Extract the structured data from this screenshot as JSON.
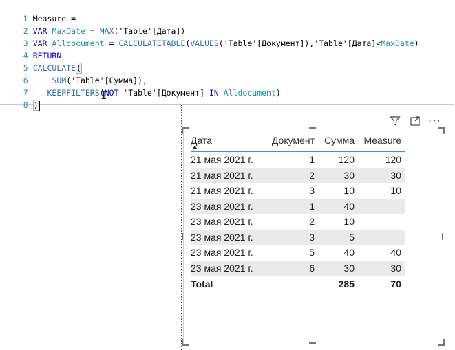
{
  "editor": {
    "lines": [
      {
        "num": "1"
      },
      {
        "num": "2"
      },
      {
        "num": "3"
      },
      {
        "num": "4"
      },
      {
        "num": "5"
      },
      {
        "num": "6"
      },
      {
        "num": "7"
      },
      {
        "num": "8"
      }
    ],
    "tokens": {
      "l1": "Measure =",
      "l2_var": "VAR",
      "l2_name": "MaxDate",
      "l2_eq": " = ",
      "l2_fn": "MAX",
      "l2_arg": "('Table'[Дата])",
      "l3_var": "VAR",
      "l3_name": "Alldocument",
      "l3_eq": " = ",
      "l3_fn1": "CALCULATETABLE",
      "l3_p1": "(",
      "l3_fn2": "VALUES",
      "l3_arg": "('Table'[Документ]),'Table'[Дата]<",
      "l3_var2": "MaxDate",
      "l3_close": ")",
      "l4": "RETURN",
      "l5_fn": "CALCULATE",
      "l5_p": "(",
      "l6_fn": "SUM",
      "l6_arg": "('Table'[Сумма]),",
      "l7_fn": "KEEPFILTERS",
      "l7_p": "(",
      "l7_not": "NOT",
      "l7_arg": " 'Table'[Документ] ",
      "l7_in": "IN",
      "l7_sp": " ",
      "l7_var": "Alldocument",
      "l7_close": ")",
      "l8": ")"
    }
  },
  "visual_header": {
    "filter_icon": "filter-icon",
    "focus_icon": "focus-mode-icon",
    "more_icon": "more-options-icon",
    "more_glyph": "···"
  },
  "matrix": {
    "columns": [
      "Дата",
      "Документ",
      "Сумма",
      "Measure"
    ],
    "rows": [
      [
        "21 мая 2021 г.",
        "1",
        "120",
        "120"
      ],
      [
        "21 мая 2021 г.",
        "2",
        "30",
        "30"
      ],
      [
        "21 мая 2021 г.",
        "3",
        "10",
        "10"
      ],
      [
        "23 мая 2021 г.",
        "1",
        "40",
        ""
      ],
      [
        "23 мая 2021 г.",
        "2",
        "10",
        ""
      ],
      [
        "23 мая 2021 г.",
        "3",
        "5",
        ""
      ],
      [
        "23 мая 2021 г.",
        "5",
        "40",
        "40"
      ],
      [
        "23 мая 2021 г.",
        "6",
        "30",
        "30"
      ]
    ],
    "total": [
      "Total",
      "",
      "285",
      "70"
    ]
  }
}
